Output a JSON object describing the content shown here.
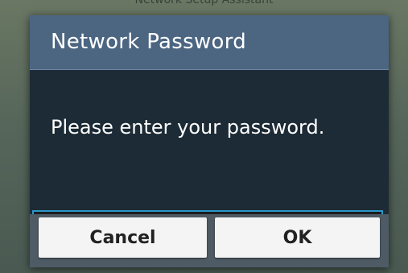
{
  "background": {
    "app_title": "Network Setup Assistant"
  },
  "dialog": {
    "title": "Network Password",
    "message": "Please enter your password.",
    "password_value": "",
    "cancel_label": "Cancel",
    "ok_label": "OK"
  },
  "colors": {
    "header": "#4c6682",
    "body": "#1c2b35",
    "input_border": "#2a97c9",
    "button_bar": "#4e5a64",
    "button": "#f4f4f4"
  }
}
